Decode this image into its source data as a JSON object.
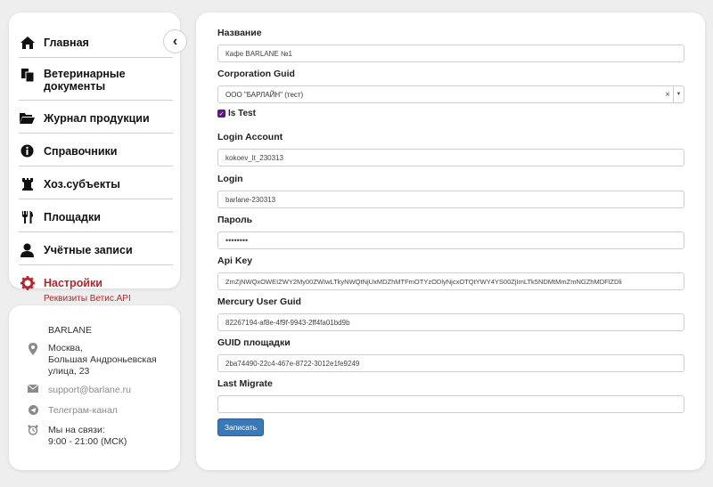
{
  "sidebar": {
    "collapse_icon": "chevron-left-icon",
    "items": [
      {
        "label": "Главная",
        "icon": "home-icon"
      },
      {
        "label": "Ветеринарные документы",
        "icon": "documents-icon"
      },
      {
        "label": "Журнал продукции",
        "icon": "folder-open-icon"
      },
      {
        "label": "Справочники",
        "icon": "info-icon"
      },
      {
        "label": "Хоз.субъекты",
        "icon": "rook-icon"
      },
      {
        "label": "Площадки",
        "icon": "cutlery-icon"
      },
      {
        "label": "Учётные записи",
        "icon": "user-icon"
      },
      {
        "label": "Настройки",
        "icon": "gear-icon",
        "active": true
      }
    ],
    "sub_link": "Реквизиты Ветис.API",
    "active_color": "#b8242a"
  },
  "contact": {
    "company": "BARLANE",
    "address_line1": "Москва,",
    "address_line2": "Большая Андроньевская",
    "address_line3": "улица, 23",
    "email": "support@barlane.ru",
    "telegram": "Телеграм-канал",
    "hours_label": "Мы на связи:",
    "hours_value": "9:00 - 21:00 (МСК)"
  },
  "form": {
    "name_label": "Название",
    "name_value": "Кафе BARLANE №1",
    "corp_label": "Corporation Guid",
    "corp_value": "ООО \"БАРЛАЙН\" (тест)",
    "is_test_label": "Is Test",
    "is_test_checked": true,
    "login_account_label": "Login Account",
    "login_account_value": "kokoev_lt_230313",
    "login_label": "Login",
    "login_value": "barlane-230313",
    "password_label": "Пароль",
    "password_value": "••••••••",
    "api_key_label": "Api Key",
    "api_key_value": "ZmZjNWQxOWEIZWY2My00ZWIwLTkyNWQtNjUxMDZhMTFmOTYzODlyNjcxOTQtYWY4YS00ZjImLTk5NDMtMmZmNGZhMDFlZDli",
    "mercury_label": "Mercury User Guid",
    "mercury_value": "82267194-af8e-4f9f-9943-2ff4fa01bd9b",
    "guid_place_label": "GUID площадки",
    "guid_place_value": "2ba74490-22c4-467e-8722-3012e1fe9249",
    "last_migrate_label": "Last Migrate",
    "last_migrate_value": "",
    "save_label": "Записать",
    "accent_color": "#3b78b8"
  }
}
